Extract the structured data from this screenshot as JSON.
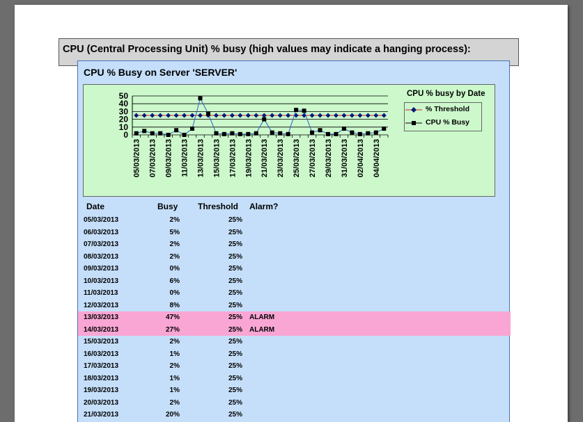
{
  "heading": "CPU (Central Processing Unit) % busy (high values may indicate a hanging process):",
  "report": {
    "title": "CPU % Busy on Server 'SERVER'",
    "columns": {
      "date": "Date",
      "busy": "Busy",
      "threshold": "Threshold",
      "alarm": "Alarm?"
    },
    "rows": [
      {
        "date": "05/03/2013",
        "busy": "2%",
        "threshold": "25%",
        "alarm": ""
      },
      {
        "date": "06/03/2013",
        "busy": "5%",
        "threshold": "25%",
        "alarm": ""
      },
      {
        "date": "07/03/2013",
        "busy": "2%",
        "threshold": "25%",
        "alarm": ""
      },
      {
        "date": "08/03/2013",
        "busy": "2%",
        "threshold": "25%",
        "alarm": ""
      },
      {
        "date": "09/03/2013",
        "busy": "0%",
        "threshold": "25%",
        "alarm": ""
      },
      {
        "date": "10/03/2013",
        "busy": "6%",
        "threshold": "25%",
        "alarm": ""
      },
      {
        "date": "11/03/2013",
        "busy": "0%",
        "threshold": "25%",
        "alarm": ""
      },
      {
        "date": "12/03/2013",
        "busy": "8%",
        "threshold": "25%",
        "alarm": ""
      },
      {
        "date": "13/03/2013",
        "busy": "47%",
        "threshold": "25%",
        "alarm": "ALARM"
      },
      {
        "date": "14/03/2013",
        "busy": "27%",
        "threshold": "25%",
        "alarm": "ALARM"
      },
      {
        "date": "15/03/2013",
        "busy": "2%",
        "threshold": "25%",
        "alarm": ""
      },
      {
        "date": "16/03/2013",
        "busy": "1%",
        "threshold": "25%",
        "alarm": ""
      },
      {
        "date": "17/03/2013",
        "busy": "2%",
        "threshold": "25%",
        "alarm": ""
      },
      {
        "date": "18/03/2013",
        "busy": "1%",
        "threshold": "25%",
        "alarm": ""
      },
      {
        "date": "19/03/2013",
        "busy": "1%",
        "threshold": "25%",
        "alarm": ""
      },
      {
        "date": "20/03/2013",
        "busy": "2%",
        "threshold": "25%",
        "alarm": ""
      },
      {
        "date": "21/03/2013",
        "busy": "20%",
        "threshold": "25%",
        "alarm": ""
      }
    ]
  },
  "colors": {
    "threshold": "#0a1a7a",
    "busy": "#000000",
    "line_busy": "#2a62c8",
    "alarm_row": "#f9a6d4"
  },
  "chart_data": {
    "type": "line",
    "title": "CPU % busy by Date",
    "legend_position": "right",
    "ylim": [
      0,
      50
    ],
    "yticks": [
      0,
      10,
      20,
      30,
      40,
      50
    ],
    "grid": true,
    "x": [
      "05/03/2013",
      "06/03/2013",
      "07/03/2013",
      "08/03/2013",
      "09/03/2013",
      "10/03/2013",
      "11/03/2013",
      "12/03/2013",
      "13/03/2013",
      "14/03/2013",
      "15/03/2013",
      "16/03/2013",
      "17/03/2013",
      "18/03/2013",
      "19/03/2013",
      "20/03/2013",
      "21/03/2013",
      "22/03/2013",
      "23/03/2013",
      "24/03/2013",
      "25/03/2013",
      "26/03/2013",
      "27/03/2013",
      "28/03/2013",
      "29/03/2013",
      "30/03/2013",
      "31/03/2013",
      "01/04/2013",
      "02/04/2013",
      "03/04/2013",
      "04/04/2013",
      "05/04/2013"
    ],
    "xtick_labels": [
      "05/03/2013",
      "07/03/2013",
      "09/03/2013",
      "11/03/2013",
      "13/03/2013",
      "15/03/2013",
      "17/03/2013",
      "19/03/2013",
      "21/03/2013",
      "23/03/2013",
      "25/03/2013",
      "27/03/2013",
      "29/03/2013",
      "31/03/2013",
      "02/04/2013",
      "04/04/2013"
    ],
    "series": [
      {
        "name": "% Threshold",
        "marker": "diamond",
        "values": [
          25,
          25,
          25,
          25,
          25,
          25,
          25,
          25,
          25,
          25,
          25,
          25,
          25,
          25,
          25,
          25,
          25,
          25,
          25,
          25,
          25,
          25,
          25,
          25,
          25,
          25,
          25,
          25,
          25,
          25,
          25,
          25
        ]
      },
      {
        "name": "CPU % Busy",
        "marker": "square",
        "values": [
          2,
          5,
          2,
          2,
          0,
          6,
          0,
          8,
          47,
          27,
          2,
          1,
          2,
          1,
          1,
          2,
          20,
          3,
          2,
          1,
          32,
          31,
          3,
          6,
          1,
          1,
          8,
          3,
          1,
          2,
          3,
          8
        ]
      }
    ]
  }
}
